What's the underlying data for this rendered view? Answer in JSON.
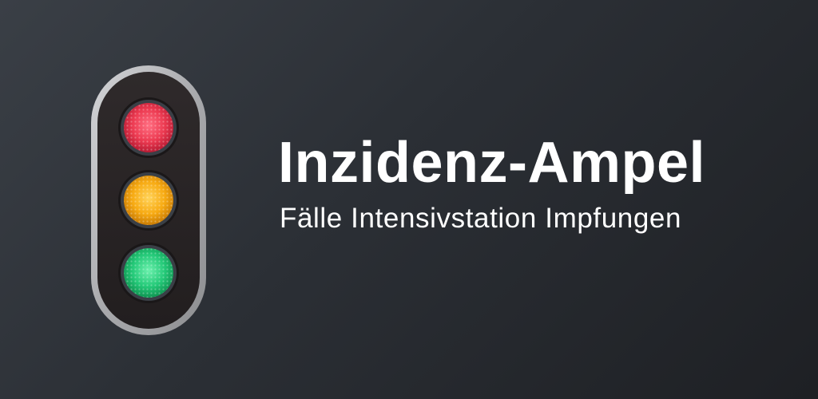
{
  "app": {
    "title": "Inzidenz-Ampel",
    "subtitle": "Fälle Intensivstation Impfungen"
  },
  "traffic_light": {
    "lights": [
      {
        "name": "red",
        "color": "#e8344b"
      },
      {
        "name": "amber",
        "color": "#f5a40f"
      },
      {
        "name": "green",
        "color": "#22c876"
      }
    ],
    "housing_color": "#2a2526",
    "frame_color": "#b7b8bb"
  }
}
